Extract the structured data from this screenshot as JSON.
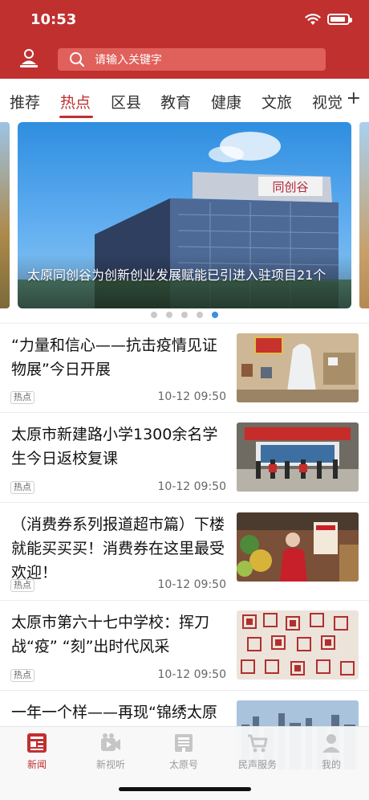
{
  "status": {
    "time": "10:53",
    "battery_level": 0.9
  },
  "search": {
    "placeholder": "请输入关键字"
  },
  "tabs": [
    {
      "label": "推荐",
      "active": false
    },
    {
      "label": "热点",
      "active": true
    },
    {
      "label": "区县",
      "active": false
    },
    {
      "label": "教育",
      "active": false
    },
    {
      "label": "健康",
      "active": false
    },
    {
      "label": "文旅",
      "active": false
    },
    {
      "label": "视觉",
      "active": false
    }
  ],
  "tab_add": "+",
  "carousel": {
    "caption": "太原同创谷为创新创业发展赋能已引进入驻项目21个",
    "building_sign": "同创谷",
    "slide_count": 5,
    "active_index": 4
  },
  "news": [
    {
      "title": "“力量和信心——抗击疫情见证物展”今日开展",
      "tag": "热点",
      "time": "10-12 09:50",
      "image": "exhibition-photo"
    },
    {
      "title": "太原市新建路小学1300余名学生今日返校复课",
      "tag": "热点",
      "time": "10-12 09:50",
      "image": "school-ceremony-photo"
    },
    {
      "title": "（消费券系列报道超市篇）下楼就能买买买！消费券在这里最受欢迎！",
      "tag": "热点",
      "time": "10-12 09:50",
      "image": "supermarket-photo"
    },
    {
      "title": "太原市第六十七中学校：挥刀战“疫” “刻”出时代风采",
      "tag": "热点",
      "time": "10-12 09:50",
      "image": "seal-carving-photo"
    },
    {
      "title": "一年一个样——再现“锦绣太原",
      "tag": "",
      "time": "",
      "image": "city-skyline-photo"
    }
  ],
  "bottom_nav": [
    {
      "label": "新闻",
      "icon": "news-icon",
      "active": true
    },
    {
      "label": "新视听",
      "icon": "video-icon",
      "active": false
    },
    {
      "label": "太原号",
      "icon": "account-icon",
      "active": false
    },
    {
      "label": "民声服务",
      "icon": "cart-icon",
      "active": false
    },
    {
      "label": "我的",
      "icon": "profile-icon",
      "active": false
    }
  ],
  "colors": {
    "brand": "#c0302f",
    "dot_active": "#3d8de3",
    "dot": "#c9c9c9",
    "search_bg": "#e0605b"
  }
}
